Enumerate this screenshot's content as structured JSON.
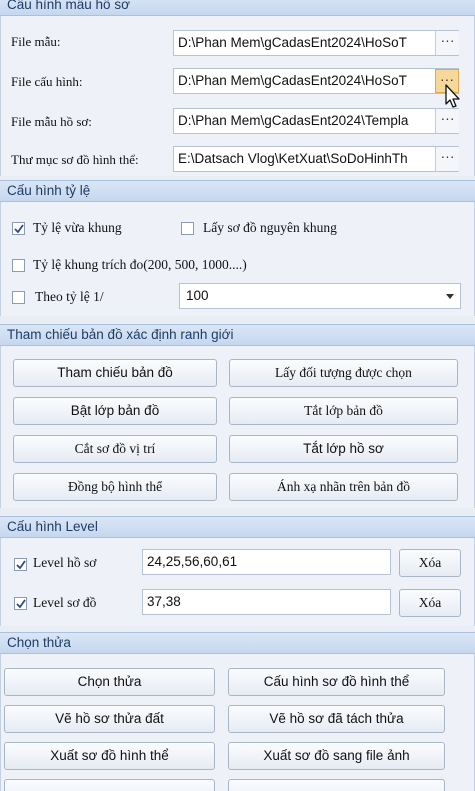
{
  "template_section": {
    "title": "Cấu hình mẫu hồ sơ",
    "rows": [
      {
        "label": "File mẫu:",
        "value": "D:\\Phan Mem\\gCadasEnt2024\\HoSoT"
      },
      {
        "label": "File cấu hình:",
        "value": "D:\\Phan Mem\\gCadasEnt2024\\HoSoT"
      },
      {
        "label": "File mẫu hồ sơ:",
        "value": "D:\\Phan Mem\\gCadasEnt2024\\Templa"
      },
      {
        "label": "Thư mục sơ đồ hình thể:",
        "value": "E:\\Datsach Vlog\\KetXuat\\SoDoHinhTh"
      }
    ],
    "browse_label": "···"
  },
  "scale_section": {
    "title": "Cấu hình tỷ lệ",
    "fit_frame": {
      "label": "Tỷ lệ vừa khung",
      "checked": true
    },
    "original_frame": {
      "label": "Lấy sơ đồ nguyên khung",
      "checked": false
    },
    "extract_frame": {
      "label": "Tỷ lệ khung trích đo(200, 500, 1000....)",
      "checked": false
    },
    "ratio": {
      "label": "Theo tỷ lệ 1/",
      "checked": false,
      "value": "100"
    }
  },
  "map_section": {
    "title": "Tham chiếu bản đồ xác định ranh giới",
    "buttons": [
      "Tham chiếu bản đồ",
      "Lấy đối tượng được chọn",
      "Bật lớp bản đồ",
      "Tắt lớp bản đồ",
      "Cắt sơ đồ vị trí",
      "Tắt lớp hồ sơ",
      "Đồng bộ hình thể",
      "Ánh xạ nhãn trên bản đồ"
    ]
  },
  "level_section": {
    "title": "Cấu hình Level",
    "profile": {
      "label": "Level hồ sơ",
      "checked": true,
      "value": "24,25,56,60,61",
      "clear": "Xóa"
    },
    "diagram": {
      "label": "Level sơ đồ",
      "checked": true,
      "value": "37,38",
      "clear": "Xóa"
    }
  },
  "parcel_section": {
    "title": "Chọn thửa",
    "buttons": [
      "Chọn thửa",
      "Cấu hình sơ đồ hình thể",
      "Vẽ hồ sơ thửa đất",
      "Vẽ hồ sơ đã tách thửa",
      "Xuất sơ đồ hình thể",
      "Xuất sơ đồ sang file ảnh"
    ]
  }
}
